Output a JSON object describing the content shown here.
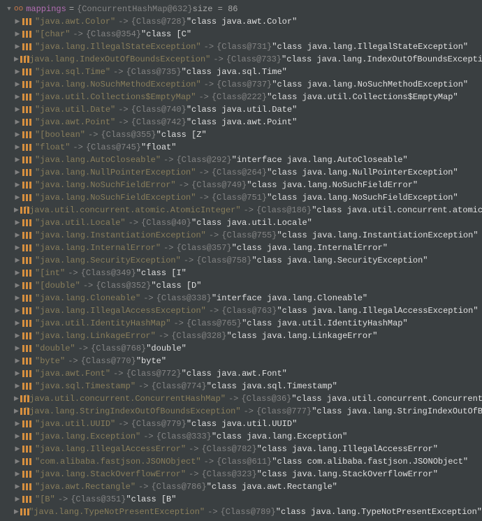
{
  "root": {
    "varName": "mappings",
    "classRef": "{ConcurrentHashMap@632}",
    "sizeLabel": " size = 86",
    "ooIcon": "oo"
  },
  "entries": [
    {
      "key": "\"java.awt.Color\"",
      "ref": "{Class@728}",
      "val": "\"class java.awt.Color\""
    },
    {
      "key": "\"[char\"",
      "ref": "{Class@354}",
      "val": "\"class [C\""
    },
    {
      "key": "\"java.lang.IllegalStateException\"",
      "ref": "{Class@731}",
      "val": "\"class java.lang.IllegalStateException\""
    },
    {
      "key": "\"java.lang.IndexOutOfBoundsException\"",
      "ref": "{Class@733}",
      "val": "\"class java.lang.IndexOutOfBoundsException\""
    },
    {
      "key": "\"java.sql.Time\"",
      "ref": "{Class@735}",
      "val": "\"class java.sql.Time\""
    },
    {
      "key": "\"java.lang.NoSuchMethodException\"",
      "ref": "{Class@737}",
      "val": "\"class java.lang.NoSuchMethodException\""
    },
    {
      "key": "\"java.util.Collections$EmptyMap\"",
      "ref": "{Class@222}",
      "val": "\"class java.util.Collections$EmptyMap\""
    },
    {
      "key": "\"java.util.Date\"",
      "ref": "{Class@740}",
      "val": "\"class java.util.Date\""
    },
    {
      "key": "\"java.awt.Point\"",
      "ref": "{Class@742}",
      "val": "\"class java.awt.Point\""
    },
    {
      "key": "\"[boolean\"",
      "ref": "{Class@355}",
      "val": "\"class [Z\""
    },
    {
      "key": "\"float\"",
      "ref": "{Class@745}",
      "val": "\"float\""
    },
    {
      "key": "\"java.lang.AutoCloseable\"",
      "ref": "{Class@292}",
      "val": "\"interface java.lang.AutoCloseable\""
    },
    {
      "key": "\"java.lang.NullPointerException\"",
      "ref": "{Class@264}",
      "val": "\"class java.lang.NullPointerException\""
    },
    {
      "key": "\"java.lang.NoSuchFieldError\"",
      "ref": "{Class@749}",
      "val": "\"class java.lang.NoSuchFieldError\""
    },
    {
      "key": "\"java.lang.NoSuchFieldException\"",
      "ref": "{Class@751}",
      "val": "\"class java.lang.NoSuchFieldException\""
    },
    {
      "key": "\"java.util.concurrent.atomic.AtomicInteger\"",
      "ref": "{Class@186}",
      "val": "\"class java.util.concurrent.atomic.AtomicInteger\""
    },
    {
      "key": "\"java.util.Locale\"",
      "ref": "{Class@40}",
      "val": "\"class java.util.Locale\""
    },
    {
      "key": "\"java.lang.InstantiationException\"",
      "ref": "{Class@755}",
      "val": "\"class java.lang.InstantiationException\""
    },
    {
      "key": "\"java.lang.InternalError\"",
      "ref": "{Class@357}",
      "val": "\"class java.lang.InternalError\""
    },
    {
      "key": "\"java.lang.SecurityException\"",
      "ref": "{Class@758}",
      "val": "\"class java.lang.SecurityException\""
    },
    {
      "key": "\"[int\"",
      "ref": "{Class@349}",
      "val": "\"class [I\""
    },
    {
      "key": "\"[double\"",
      "ref": "{Class@352}",
      "val": "\"class [D\""
    },
    {
      "key": "\"java.lang.Cloneable\"",
      "ref": "{Class@338}",
      "val": "\"interface java.lang.Cloneable\""
    },
    {
      "key": "\"java.lang.IllegalAccessException\"",
      "ref": "{Class@763}",
      "val": "\"class java.lang.IllegalAccessException\""
    },
    {
      "key": "\"java.util.IdentityHashMap\"",
      "ref": "{Class@765}",
      "val": "\"class java.util.IdentityHashMap\""
    },
    {
      "key": "\"java.lang.LinkageError\"",
      "ref": "{Class@328}",
      "val": "\"class java.lang.LinkageError\""
    },
    {
      "key": "\"double\"",
      "ref": "{Class@768}",
      "val": "\"double\""
    },
    {
      "key": "\"byte\"",
      "ref": "{Class@770}",
      "val": "\"byte\""
    },
    {
      "key": "\"java.awt.Font\"",
      "ref": "{Class@772}",
      "val": "\"class java.awt.Font\""
    },
    {
      "key": "\"java.sql.Timestamp\"",
      "ref": "{Class@774}",
      "val": "\"class java.sql.Timestamp\""
    },
    {
      "key": "\"java.util.concurrent.ConcurrentHashMap\"",
      "ref": "{Class@36}",
      "val": "\"class java.util.concurrent.ConcurrentHashMap\""
    },
    {
      "key": "\"java.lang.StringIndexOutOfBoundsException\"",
      "ref": "{Class@777}",
      "val": "\"class java.lang.StringIndexOutOfBoundsException\""
    },
    {
      "key": "\"java.util.UUID\"",
      "ref": "{Class@779}",
      "val": "\"class java.util.UUID\""
    },
    {
      "key": "\"java.lang.Exception\"",
      "ref": "{Class@333}",
      "val": "\"class java.lang.Exception\""
    },
    {
      "key": "\"java.lang.IllegalAccessError\"",
      "ref": "{Class@782}",
      "val": "\"class java.lang.IllegalAccessError\""
    },
    {
      "key": "\"com.alibaba.fastjson.JSONObject\"",
      "ref": "{Class@611}",
      "val": "\"class com.alibaba.fastjson.JSONObject\""
    },
    {
      "key": "\"java.lang.StackOverflowError\"",
      "ref": "{Class@323}",
      "val": "\"class java.lang.StackOverflowError\""
    },
    {
      "key": "\"java.awt.Rectangle\"",
      "ref": "{Class@786}",
      "val": "\"class java.awt.Rectangle\""
    },
    {
      "key": "\"[B\"",
      "ref": "{Class@351}",
      "val": "\"class [B\""
    },
    {
      "key": "\"java.lang.TypeNotPresentException\"",
      "ref": "{Class@789}",
      "val": "\"class java.lang.TypeNotPresentException\""
    }
  ],
  "arrows": {
    "right": "▶",
    "down": "▼"
  },
  "mapArrow": "->"
}
